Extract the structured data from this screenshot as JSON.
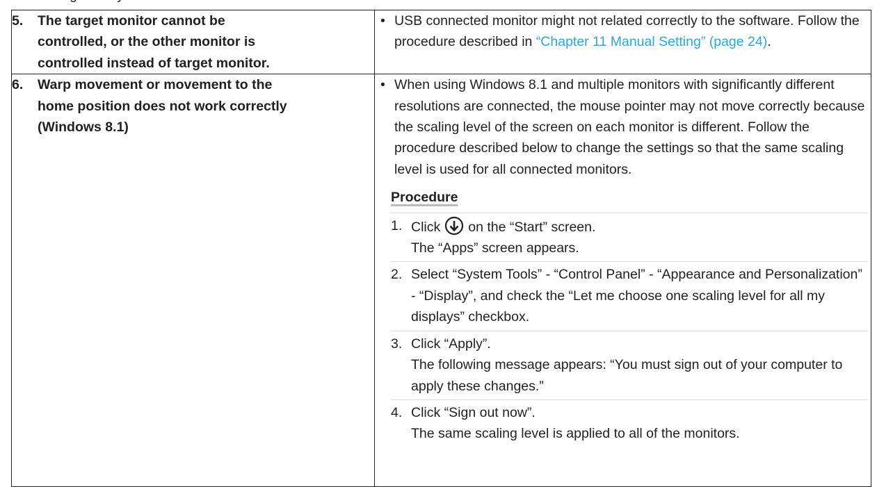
{
  "top_fragment": "...scaling is ... by ...",
  "rows": [
    {
      "number": "5.",
      "problem_lines": [
        "The target monitor cannot be",
        "controlled, or the other monitor is",
        "controlled instead of target monitor."
      ],
      "solution": {
        "bullet": "•",
        "text_before_link": "USB connected monitor might not related correctly to the software. Follow the procedure described in ",
        "link_text": "“Chapter 11 Manual Setting” (page 24)",
        "text_after_link": "."
      }
    },
    {
      "number": "6.",
      "problem_lines": [
        "Warp movement or movement to the",
        "home position does not work correctly",
        "(Windows 8.1)"
      ],
      "solution": {
        "bullet": "•",
        "text": "When using Windows 8.1 and multiple monitors with significantly different resolutions are connected, the mouse pointer may not move correctly because the scaling level of the screen on each monitor is different. Follow the procedure described below to change the settings so that the same scaling level is used for all connected monitors.",
        "procedure_title": "Procedure",
        "steps": [
          {
            "num": "1.",
            "line1_before_icon": "Click",
            "icon": "down-arrow-circle-icon",
            "line1_after_icon": "on the “Start” screen.",
            "line2": "The “Apps” screen appears."
          },
          {
            "num": "2.",
            "line1": "Select “System Tools” - “Control Panel” - “Appearance and Personalization” - “Display”, and check the “Let me choose one scaling level for all my displays” checkbox."
          },
          {
            "num": "3.",
            "line1": "Click “Apply”.",
            "line2": "The following message appears: “You must sign out of your computer to apply these changes.”"
          },
          {
            "num": "4.",
            "line1": "Click “Sign out now”.",
            "line2": "The same scaling level is applied to all of the monitors."
          }
        ]
      }
    }
  ],
  "colors": {
    "text": "#231f20",
    "link": "#2aa7df"
  }
}
